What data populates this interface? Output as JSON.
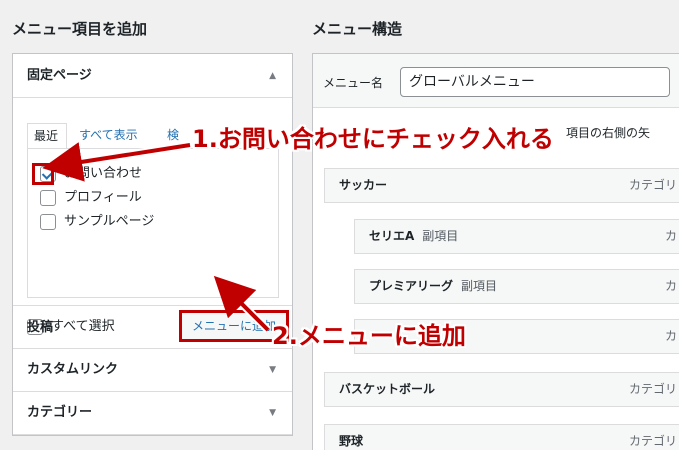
{
  "left": {
    "title": "メニュー項目を追加",
    "pages_panel": {
      "title": "固定ページ",
      "tabs": [
        "最近",
        "すべて表示",
        "検"
      ],
      "items": [
        {
          "label": "お問い合わせ",
          "checked": true
        },
        {
          "label": "プロフィール",
          "checked": false
        },
        {
          "label": "サンプルページ",
          "checked": false
        }
      ],
      "select_all": "すべて選択",
      "add_button": "メニューに追加"
    },
    "sections": [
      "投稿",
      "カスタムリンク",
      "カテゴリー"
    ]
  },
  "right": {
    "title": "メニュー構造",
    "name_label": "メニュー名",
    "name_value": "グローバルメニュー",
    "instructions_fragment": "項目の右側の矢",
    "items": [
      {
        "title": "サッカー",
        "sub": "",
        "type": "カテゴリ"
      },
      {
        "title": "セリエA",
        "sub": "副項目",
        "type": "カ"
      },
      {
        "title": "プレミアリーグ",
        "sub": "副項目",
        "type": "カ"
      },
      {
        "title": "",
        "sub": "",
        "type": "カ"
      },
      {
        "title": "バスケットボール",
        "sub": "",
        "type": "カテゴリ"
      },
      {
        "title": "野球",
        "sub": "",
        "type": "カテゴリ"
      }
    ]
  },
  "annotations": {
    "step1": "1.お問い合わせにチェック入れる",
    "step2": "2.メニューに追加"
  },
  "colors": {
    "annotation_red": "#c00000",
    "link_blue": "#2271b1",
    "background": "#f0f0f1"
  }
}
